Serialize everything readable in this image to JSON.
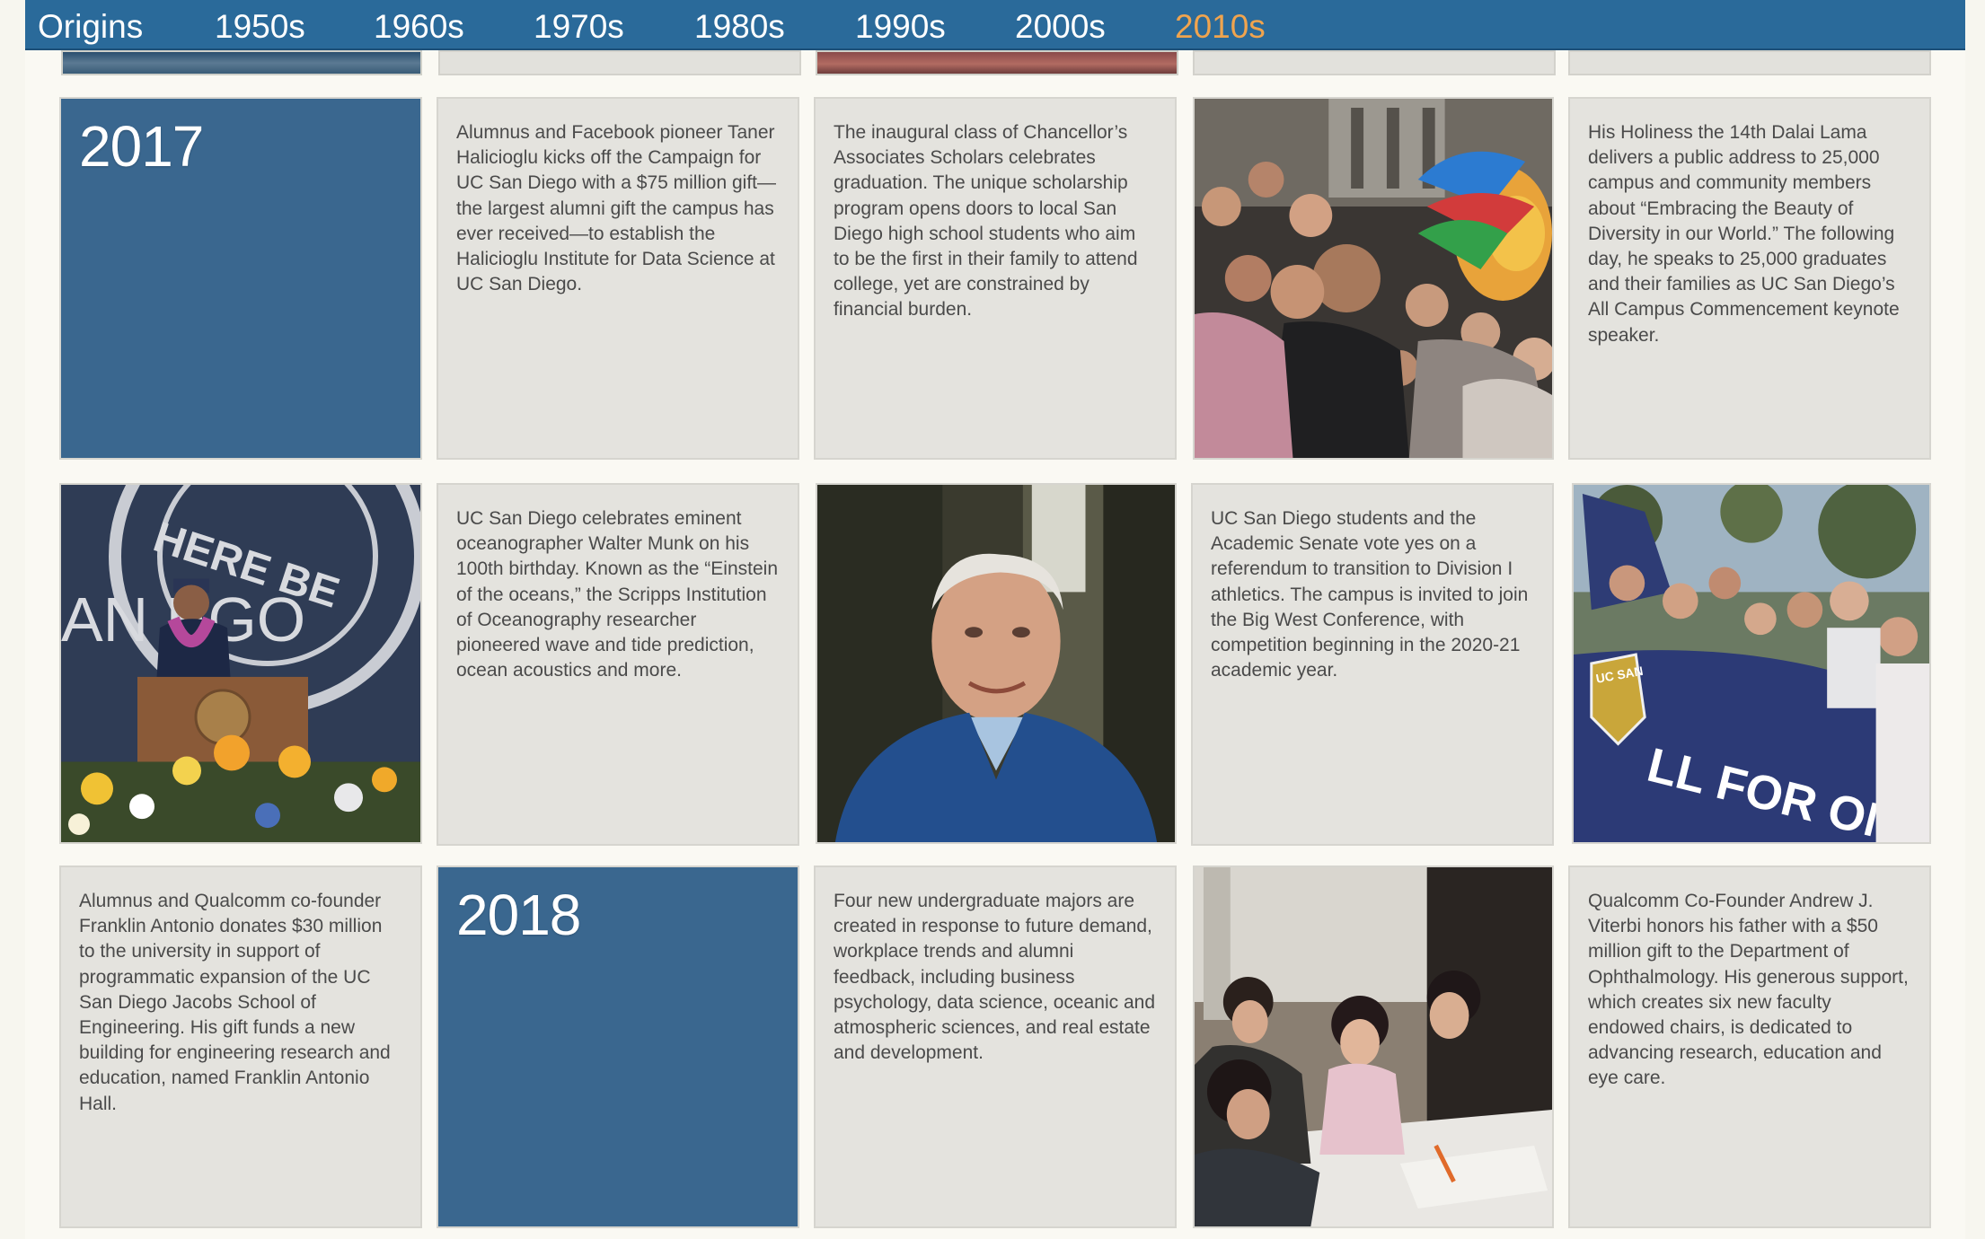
{
  "nav": {
    "items": [
      {
        "label": "Origins",
        "active": false
      },
      {
        "label": "1950s",
        "active": false
      },
      {
        "label": "1960s",
        "active": false
      },
      {
        "label": "1970s",
        "active": false
      },
      {
        "label": "1980s",
        "active": false
      },
      {
        "label": "1990s",
        "active": false
      },
      {
        "label": "2000s",
        "active": false
      },
      {
        "label": "2010s",
        "active": true
      }
    ],
    "active_color": "#f0a44e",
    "bar_color": "#2a6a9a"
  },
  "timeline": {
    "year_2017": "2017",
    "year_2018": "2018",
    "tile_color": "#3a678f",
    "entries": {
      "halicioglu": "Alumnus and Facebook pioneer Taner Halicioglu kicks off the Campaign for UC San Diego with a $75 million gift—the largest alumni gift the campus has ever received—to establish the Halicioglu Institute for Data Science at UC San Diego.",
      "chancellors_scholars": "The inaugural class of Chancellor’s Associates Scholars celebrates graduation. The unique scholarship program opens doors to local San Diego high school students who aim to be the first in their family to attend college, yet are constrained by financial burden.",
      "dalai_lama": "His Holiness the 14th Dalai Lama delivers a public address to 25,000 campus and community members about “Embracing the Beauty of Diversity in our World.” The following day, he speaks to 25,000 graduates and their families as UC San Diego’s All Campus Commencement keynote speaker.",
      "walter_munk": "UC San Diego celebrates eminent oceanographer Walter Munk on his 100th birthday. Known as the “Einstein of the oceans,” the Scripps Institution of Oceanography researcher pioneered wave and tide prediction, ocean acoustics and more.",
      "division_one": "UC San Diego students and the Academic Senate vote yes on a referendum to transition to Division I athletics. The campus is invited to join the Big West Conference, with competition beginning in the 2020-21 academic year.",
      "franklin_antonio": "Alumnus and Qualcomm co-founder Franklin Antonio donates $30 million to the university in support of programmatic expansion of the UC San Diego Jacobs School of Engineering. His gift funds a new building for engineering research and education, named Franklin Antonio Hall.",
      "new_majors": "Four new undergraduate majors are created in response to future demand, workplace trends and alumni feedback, including business psychology, data science, oceanic and atmospheric sciences, and real estate and development.",
      "viterbi": "Qualcomm Co-Founder Andrew J. Viterbi honors his father with a $50 million gift to the Department of Ophthalmology. His generous support, which creates six new faculty endowed chairs, is dedicated to advancing research, education and eye care."
    }
  },
  "photos": {
    "dalai_lama_podium_banner_text": "HERE BE",
    "dalai_lama_podium_banner_text2": "AN   EGO",
    "rally_banner_text": "LL FOR ONE.",
    "rally_shield_text": "UC SAN"
  }
}
